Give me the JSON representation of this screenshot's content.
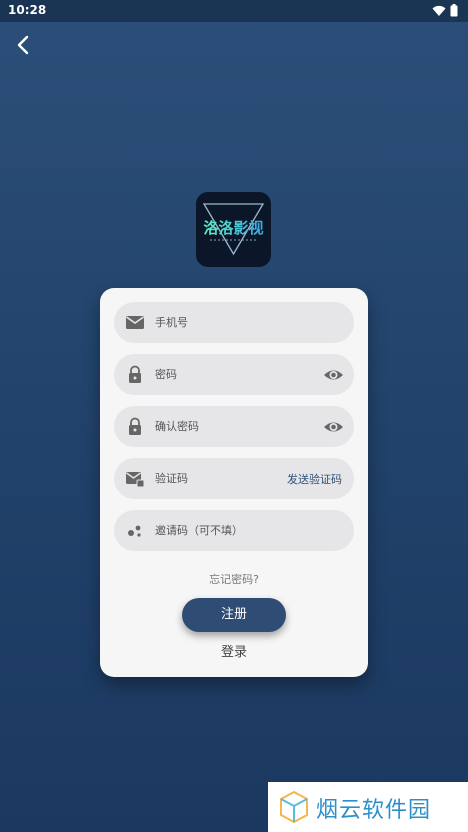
{
  "status": {
    "time": "10:28"
  },
  "form": {
    "phone_placeholder": "手机号",
    "password_placeholder": "密码",
    "confirm_placeholder": "确认密码",
    "code_placeholder": "验证码",
    "send_code": "发送验证码",
    "invite_placeholder": "邀请码（可不填）",
    "forgot": "忘记密码?",
    "register": "注册",
    "login": "登录"
  },
  "logo": {
    "text": "洛洛影视"
  },
  "watermark": {
    "text": "烟云软件园"
  },
  "colors": {
    "accent": "#2f4c74",
    "send_link": "#2f4f78",
    "watermark": "#2d8fc9"
  }
}
